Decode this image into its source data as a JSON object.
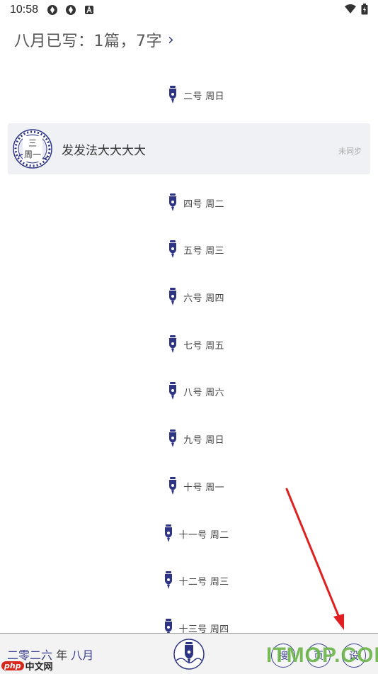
{
  "status_bar": {
    "time": "10:58",
    "icons": [
      "sync-icon",
      "sync-icon",
      "a-icon"
    ],
    "right_icons": [
      "wifi-icon",
      "battery-icon"
    ]
  },
  "header": {
    "title": "八月已写：1篇，7字",
    "chevron": "›"
  },
  "days": [
    {
      "label": "二号 周日"
    },
    {
      "label": "四号 周二"
    },
    {
      "label": "五号 周三"
    },
    {
      "label": "六号 周四"
    },
    {
      "label": "七号 周五"
    },
    {
      "label": "八号 周六"
    },
    {
      "label": "九号 周日"
    },
    {
      "label": "十号 周一"
    },
    {
      "label": "十一号 周二"
    },
    {
      "label": "十二号 周三"
    },
    {
      "label": "十三号 周四"
    }
  ],
  "entry": {
    "badge_top": "三",
    "badge_bottom": "周一",
    "title": "发发法大大大大",
    "sync_status": "未同步"
  },
  "bottom_bar": {
    "date_part1": "二零二六",
    "date_part2": "年",
    "date_part3": "八月",
    "button_1": "搜",
    "button_2": "页",
    "button_3": "设"
  },
  "watermarks": {
    "php_tag": "php",
    "php_text": "中文网",
    "itmop": "ITMOP.COM"
  },
  "colors": {
    "accent": "#3a3f8f",
    "arrow": "#e02020",
    "card_bg": "#f0f1f4"
  }
}
